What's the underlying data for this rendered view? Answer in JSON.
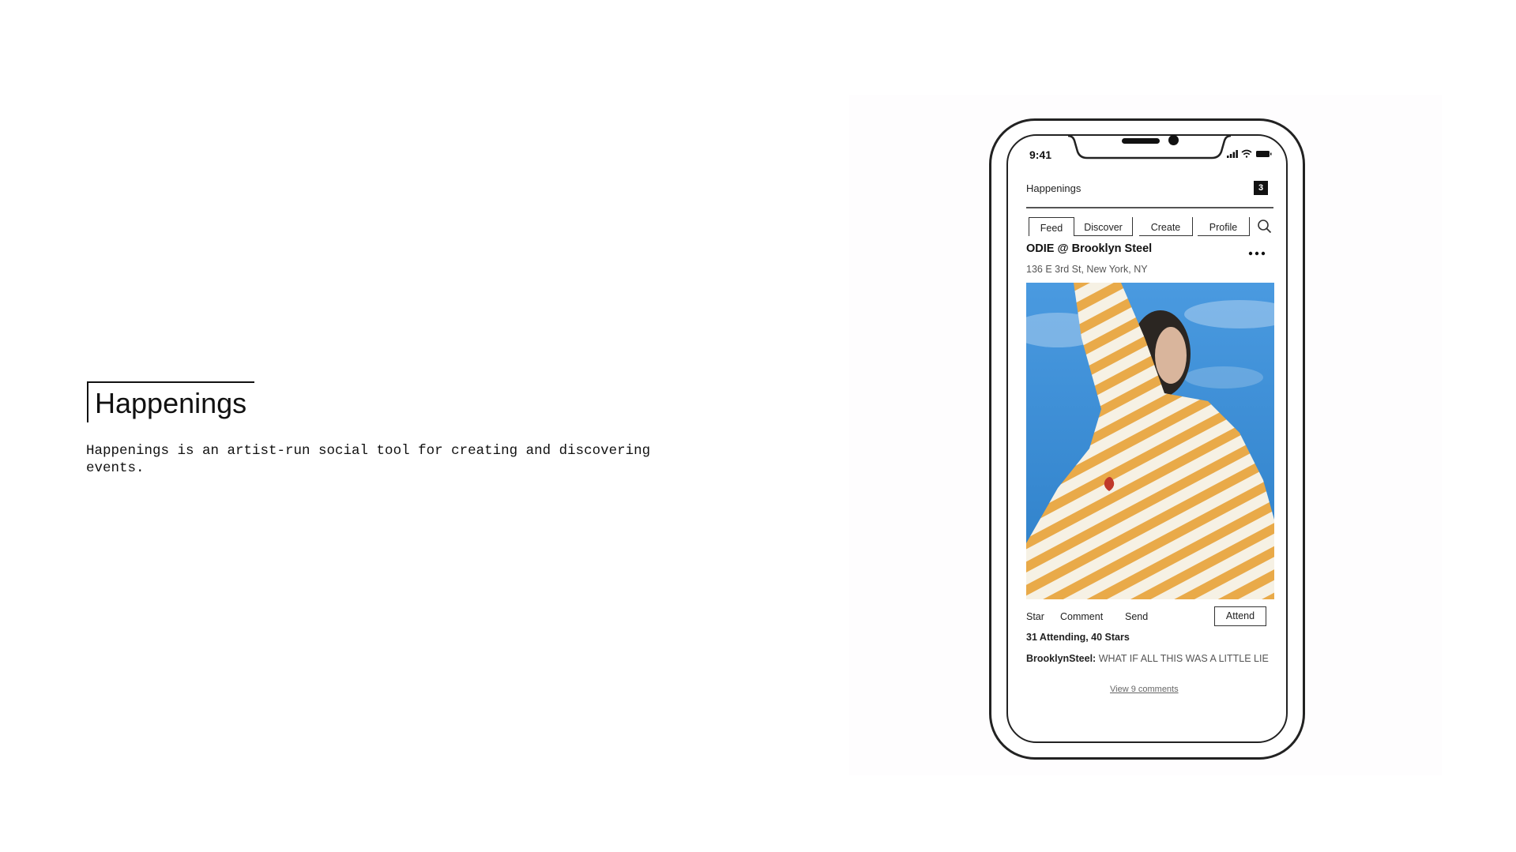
{
  "intro": {
    "title": "Happenings",
    "description": "Happenings is an artist-run social tool for creating and discovering events."
  },
  "phone": {
    "status_bar": {
      "time": "9:41",
      "icons": [
        "signal-icon",
        "wifi-icon",
        "battery-icon"
      ]
    },
    "header": {
      "title": "Happenings",
      "notification_count": "3"
    },
    "tabs": [
      {
        "label": "Feed",
        "active": true
      },
      {
        "label": "Discover",
        "active": false
      },
      {
        "label": "Create",
        "active": false
      },
      {
        "label": "Profile",
        "active": false
      }
    ],
    "post": {
      "title": "ODIE @ Brooklyn Steel",
      "address": "136 E 3rd St, New York, NY",
      "actions": {
        "star": "Star",
        "comment": "Comment",
        "send": "Send",
        "attend": "Attend"
      },
      "stats": "31 Attending, 40 Stars",
      "caption": {
        "author": "BrooklynSteel:",
        "text": " WHAT IF ALL THIS WAS A LITTLE LIE"
      },
      "view_comments": "View 9 comments"
    }
  },
  "colors": {
    "sky": "#3f8fd4",
    "stripe": "#e8a33a",
    "ink": "#111111"
  }
}
